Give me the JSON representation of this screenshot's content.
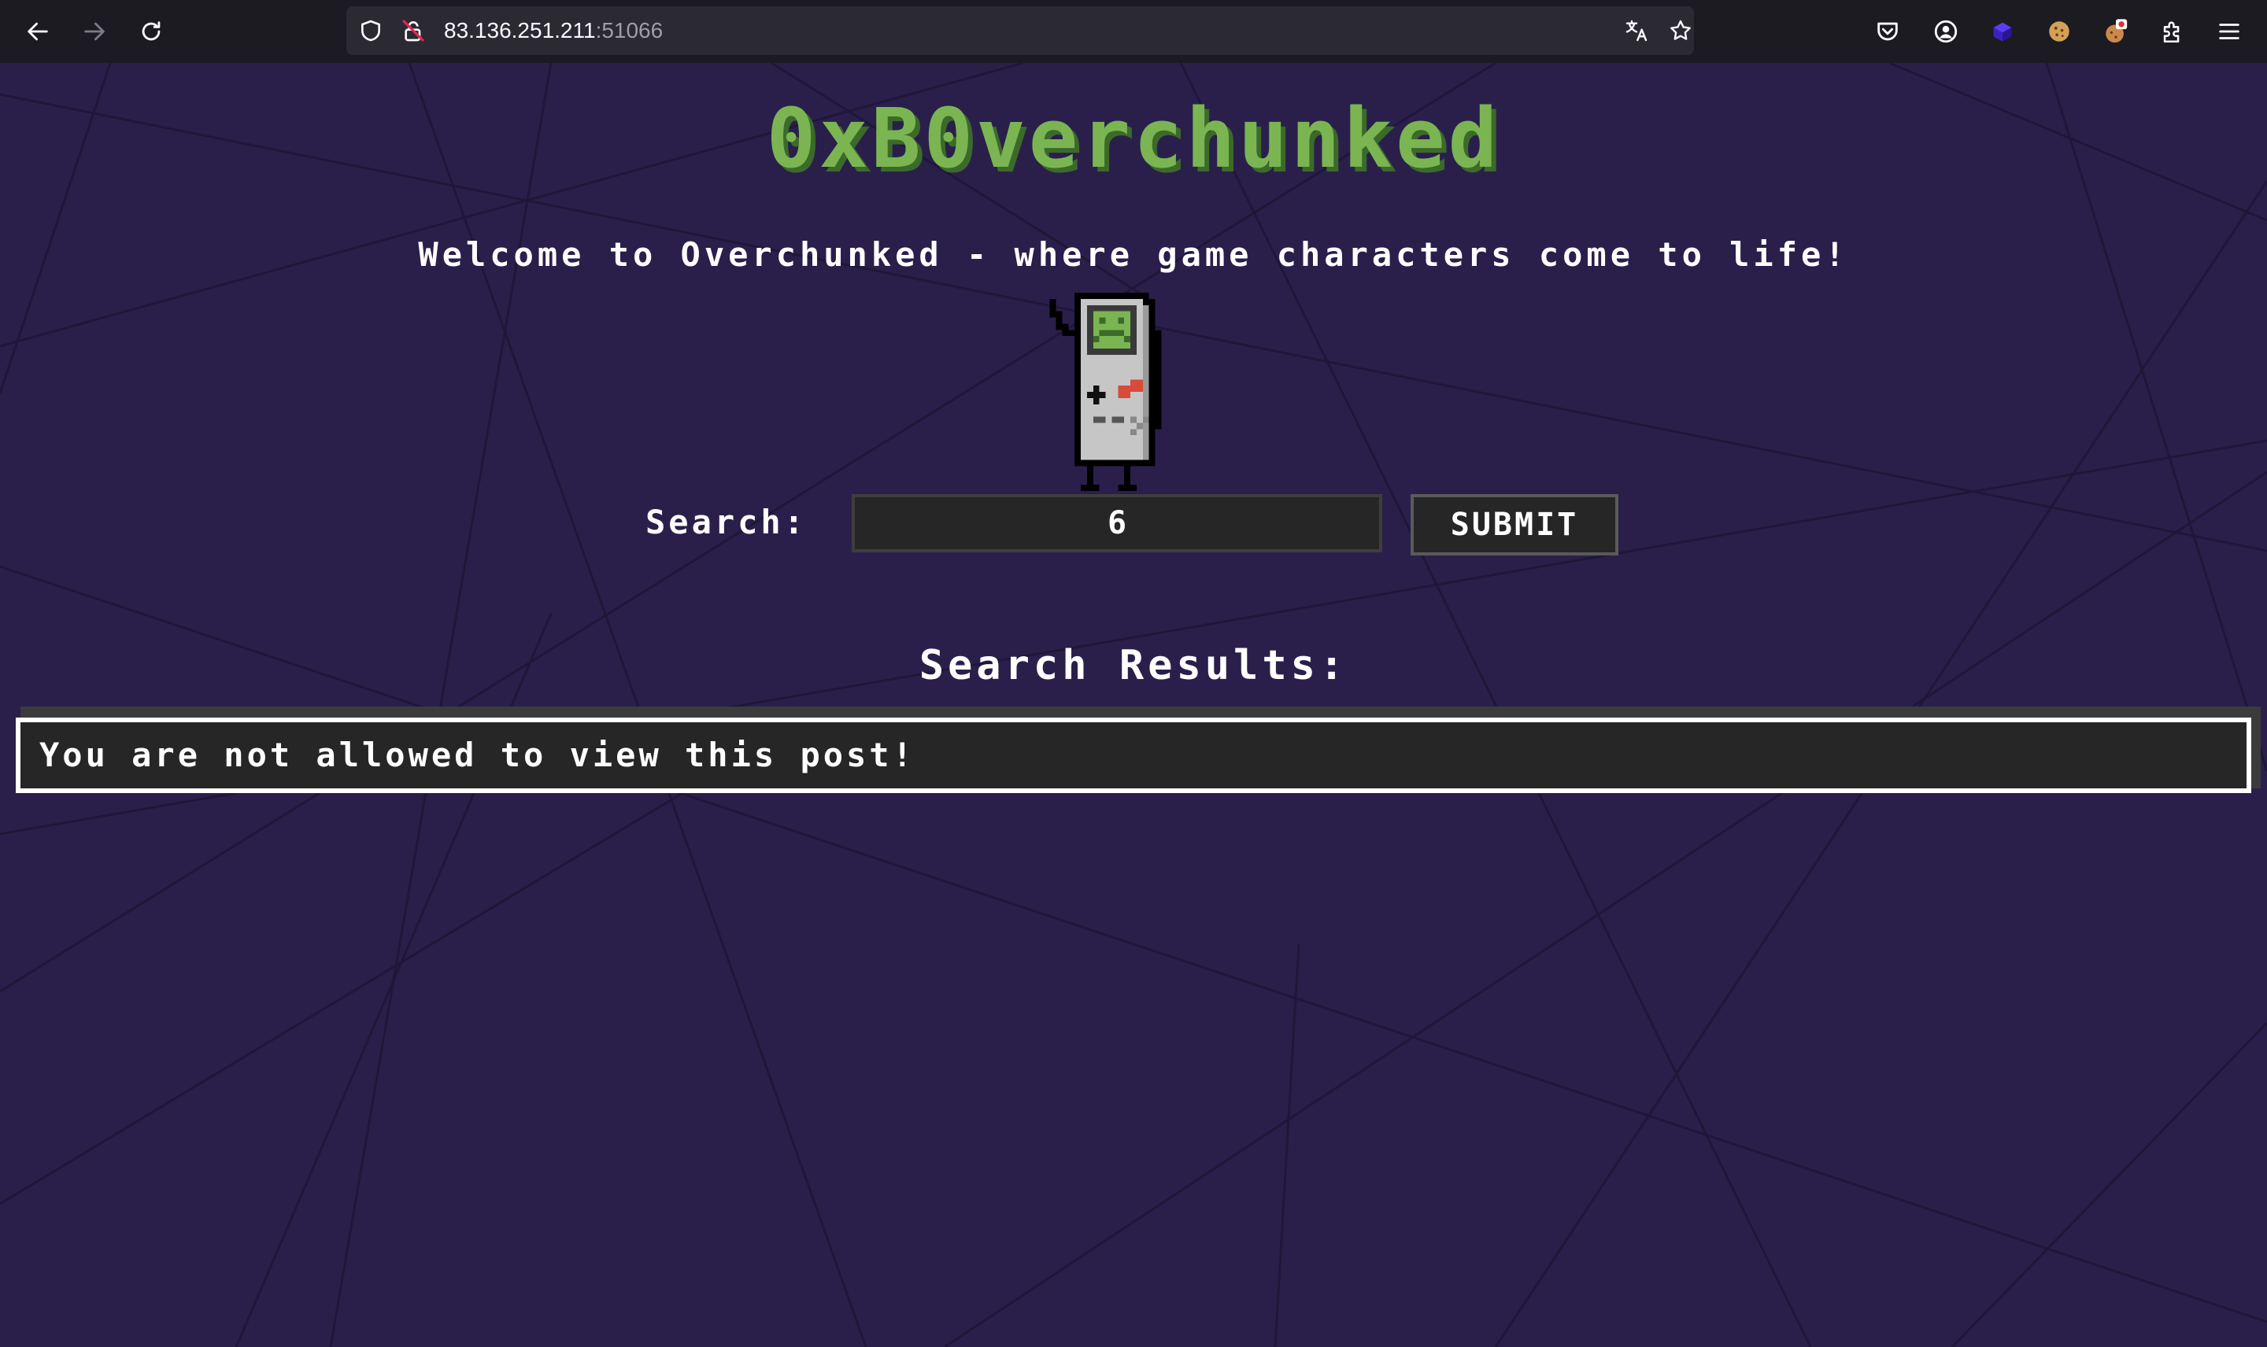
{
  "browser": {
    "url_host": "83.136.251.211",
    "url_port": ":51066",
    "icons": {
      "back": "back-arrow-icon",
      "forward": "forward-arrow-icon",
      "reload": "reload-icon",
      "shield": "tracking-protection-shield-icon",
      "insecure": "insecure-lock-icon",
      "translate": "translate-icon",
      "bookmark": "bookmark-star-icon",
      "pocket": "pocket-icon",
      "account": "account-icon",
      "extension1": "purple-cube-extension-icon",
      "extension2": "cookie-extension-icon",
      "extension3": "cookie-badge-extension-icon",
      "extensions": "extensions-puzzle-icon",
      "menu": "hamburger-menu-icon"
    }
  },
  "page": {
    "title": "0xB0verchunked",
    "welcome": "Welcome to Overchunked - where game characters come to life!",
    "mascot": "gameboy-mascot-icon",
    "search": {
      "label": "Search:",
      "value": "6",
      "submit_label": "SUBMIT"
    },
    "results_heading": "Search Results:",
    "result_message": "You are not allowed to view this post!"
  },
  "colors": {
    "background": "#2a1f4b",
    "title_green": "#7ab552",
    "title_shadow": "#3c6a2a",
    "panel_dark": "#262626",
    "text": "#ffffff"
  }
}
